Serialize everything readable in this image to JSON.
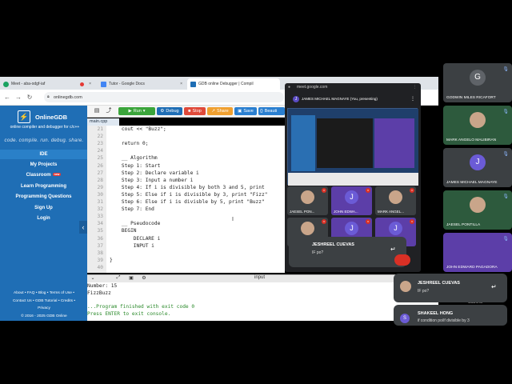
{
  "browser": {
    "tabs": [
      {
        "label": "Meet - aba-odgf-iaf",
        "color": "#1aa260"
      },
      {
        "label": "Tutor - Google Docs",
        "color": "#4285f4"
      },
      {
        "label": "GDB online Debugger | Compil",
        "color": "#1f6eb5"
      }
    ],
    "url": "onlinegdb.com"
  },
  "sidebar": {
    "logo_glyph": "⚡",
    "logo_text": "OnlineGDB",
    "tagline": "online compiler and debugger for c/c++",
    "motto": "code. compile. run. debug. share.",
    "links": [
      "IDE",
      "My Projects",
      "Classroom",
      "Learn Programming",
      "Programming Questions",
      "Sign Up",
      "Login"
    ],
    "new_badge": "new",
    "footer_line1": "About • FAQ • Blog • Terms of Use •",
    "footer_line2": "Contact Us • GDB Tutorial • Credits •",
    "footer_line3": "Privacy",
    "footer_line4": "© 2016 - 2025 GDB Online"
  },
  "toolbar": {
    "run": "Run",
    "debug": "Debug",
    "stop": "Stop",
    "share": "Share",
    "save": "Save",
    "beautify": "Beauti",
    "file_tab": "main.cpp"
  },
  "editor": {
    "line_numbers": [
      "21",
      "22",
      "23",
      "24",
      "25",
      "26",
      "27",
      "28",
      "29",
      "30",
      "31",
      "32",
      "33",
      "34",
      "35",
      "36",
      "37",
      "38",
      "39",
      "40"
    ],
    "lines": [
      "    cout << \"Buzz\";",
      "",
      "    return 0;",
      "",
      "    __ Algorithm",
      "    Step 1: Start",
      "    Step 2: Declare variable i",
      "    Step 3: Input a number i",
      "    Step 4: If i is divisible by both 3 and 5, print",
      "    Step 5: Else if i is divisible by 3, print \"Fizz\"",
      "    Step 6: Else if i is divisble by 5, print \"Buzz\"",
      "    Step 7: End",
      "",
      "    __ Pseudocode",
      "    BEGIN",
      "        DECLARE i",
      "        INPUT i",
      "",
      "}",
      ""
    ]
  },
  "console": {
    "title": "input",
    "lines": [
      "Number: 15",
      "FizzBuzz",
      "",
      "...Program finished with exit code 0",
      "Press ENTER to exit console."
    ]
  },
  "meet": {
    "url": "meet.google.com",
    "presenting": "JAMES MICHAEL MAGNAYE (You, presenting)",
    "tiles": [
      {
        "name": "JAESEL PON...",
        "type": "face"
      },
      {
        "name": "JOHN EDWA...",
        "type": "letter",
        "letter": "J"
      },
      {
        "name": "MARK ANGEL...",
        "type": "face"
      },
      {
        "name": "",
        "type": "face"
      },
      {
        "name": "",
        "type": "letter",
        "letter": "J"
      },
      {
        "name": "",
        "type": "letter",
        "letter": "J"
      }
    ],
    "chat_name": "JESHREEL CUEVAS",
    "chat_msg": "IF po?",
    "reply_glyph": "↵"
  },
  "participants": [
    {
      "name": "GODWIN MILES RICAFORT",
      "type": "letter",
      "letter": "G",
      "color": "#5f6368"
    },
    {
      "name": "MARK ANGELO MALIBIRAN",
      "type": "face"
    },
    {
      "name": "JAMES MICHAEL MAGNAYE",
      "type": "letter",
      "letter": "J",
      "color": "#6b5bd6"
    },
    {
      "name": "JAESEL PONTILLA",
      "type": "face"
    },
    {
      "name": "JOHN EDWARD PAGADORA",
      "type": "letter",
      "letter": "",
      "color": "#5c3ea8"
    }
  ],
  "notifications": [
    {
      "name": "JESHREEL CUEVAS",
      "msg": "IF po?"
    },
    {
      "name": "SHAKEEL HONG",
      "msg": "if condition po/if divisible by 3",
      "initial": "S"
    }
  ],
  "bg_name": "CUEVAS"
}
